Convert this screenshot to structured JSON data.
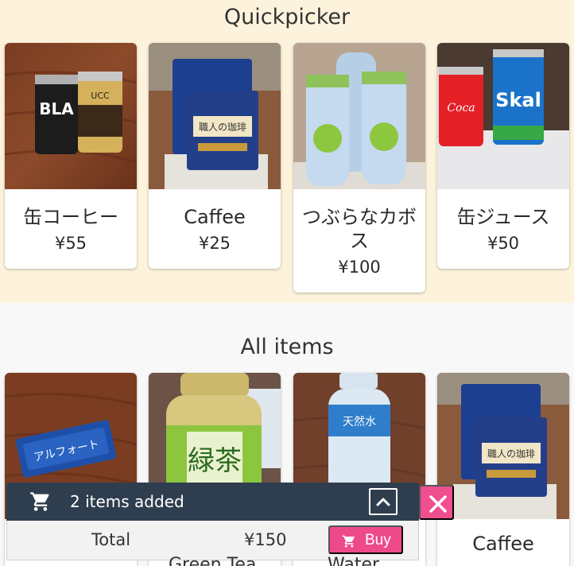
{
  "quickpicker": {
    "title": "Quickpicker",
    "items": [
      {
        "name": "缶コーヒー",
        "price": "¥55",
        "image": "canned-coffee-photo"
      },
      {
        "name": "Caffee",
        "price": "¥25",
        "image": "drip-coffee-packs-photo"
      },
      {
        "name": "つぶらなカボス",
        "price": "¥100",
        "image": "kabosu-bottles-photo"
      },
      {
        "name": "缶ジュース",
        "price": "¥50",
        "image": "canned-juice-photo"
      }
    ]
  },
  "all_items": {
    "title": "All items",
    "items": [
      {
        "name": "",
        "image": "alfort-snack-photo"
      },
      {
        "name": "Green Tea",
        "image": "green-tea-bottle-photo"
      },
      {
        "name": "Water",
        "image": "water-bottle-photo"
      },
      {
        "name": "Caffee",
        "image": "drip-coffee-packs-photo"
      }
    ]
  },
  "cart": {
    "summary": "2 items added",
    "total_label": "Total",
    "total_value": "¥150",
    "buy_label": "Buy",
    "icons": {
      "cart": "shopping-cart-icon",
      "toggle": "chevron-up-icon",
      "close": "close-icon"
    }
  },
  "colors": {
    "quick_bg": "#fdf3dc",
    "cart_bar": "#2f3e4e",
    "accent_pink": "#ee4a8b"
  }
}
